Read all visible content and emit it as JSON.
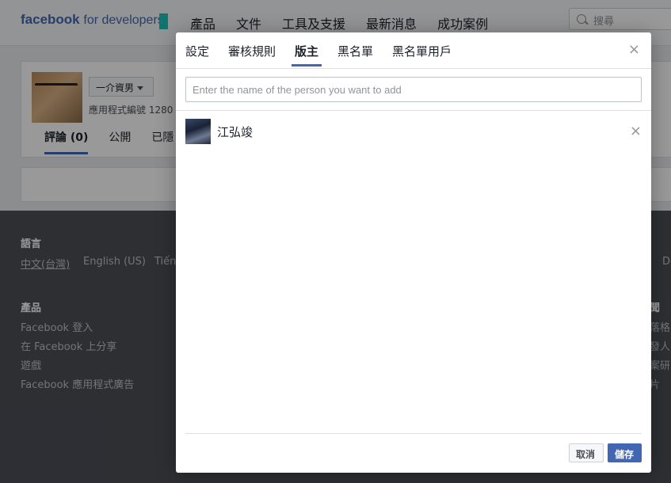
{
  "header": {
    "logo_bold": "facebook",
    "logo_rest": "for developers",
    "nav": [
      "產品",
      "文件",
      "工具及支援",
      "最新消息",
      "成功案例"
    ],
    "search_placeholder": "搜尋"
  },
  "app": {
    "category": "一介資男",
    "app_id": "應用程式編號 1280",
    "tabs": [
      "評論 (0)",
      "公開",
      "已隱"
    ]
  },
  "footer": {
    "language_heading": "語言",
    "languages": [
      "中文(台灣)",
      "English (US)",
      "Tiếng",
      "De"
    ],
    "products_heading": "產品",
    "products": [
      "Facebook 登入",
      "在 Facebook 上分享",
      "遊戲",
      "Facebook 應用程式廣告"
    ],
    "right_heading": "聞",
    "right_items": [
      "落格",
      "發人",
      "案研",
      "片"
    ]
  },
  "dialog": {
    "tabs": [
      "設定",
      "審核規則",
      "版主",
      "黑名單",
      "黑名單用戶"
    ],
    "active_tab": "版主",
    "input_placeholder": "Enter the name of the person you want to add",
    "moderators": [
      {
        "name": "江弘竣"
      }
    ],
    "cancel_label": "取消",
    "save_label": "儲存",
    "close_symbol": "×"
  },
  "colors": {
    "accent": "#4267b2",
    "brand_mark": "#1bc2ba",
    "footer_bg": "#4b4f56"
  }
}
